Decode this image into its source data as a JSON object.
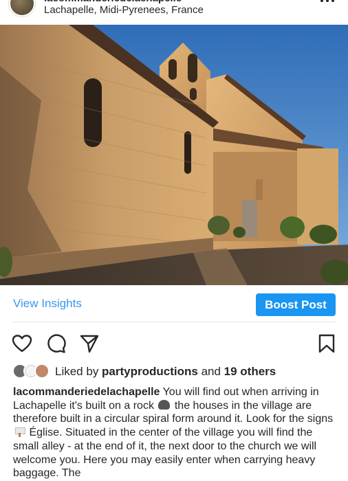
{
  "header": {
    "username": "lacommanderiedelachapelle",
    "location": "Lachapelle, Midi-Pyrenees, France"
  },
  "photo": {
    "subject": "church-with-bell-tower-at-sunset"
  },
  "insights": {
    "view_insights_label": "View Insights",
    "boost_post_label": "Boost Post"
  },
  "actions": {
    "icons": [
      "heart-icon",
      "comment-icon",
      "share-icon",
      "bookmark-icon"
    ]
  },
  "likes": {
    "prefix": "Liked by ",
    "user": "partyproductions",
    "middle": " and ",
    "others": "19 others"
  },
  "caption": {
    "username": "lacommanderiedelachapelle",
    "part1": " You will find out when arriving in Lachapelle it's built on a rock ",
    "part2": " the houses in the village are therefore built in a circular spiral form around it. Look for the signs ",
    "part3": " Église. Situated in the center of the village you will find the small alley - at the end of it, the next door to the church we will welcome you. Here you may easily enter when carrying heavy baggage. The"
  },
  "colors": {
    "link_blue": "#3897f0",
    "button_blue": "#1b95f2",
    "text": "#262626",
    "sky": "#3d7bc4",
    "stone": "#c89a62"
  }
}
